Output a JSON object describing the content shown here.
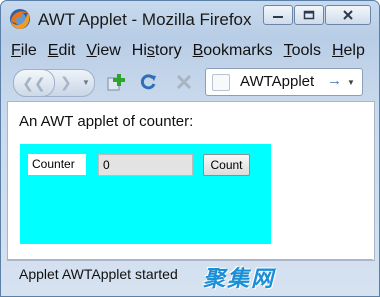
{
  "window": {
    "title": "AWT Applet - Mozilla Firefox"
  },
  "menu": [
    {
      "label": "File",
      "mnemonic": "F",
      "rest": "ile"
    },
    {
      "label": "Edit",
      "mnemonic": "E",
      "rest": "dit"
    },
    {
      "label": "View",
      "mnemonic": "V",
      "rest": "iew"
    },
    {
      "label": "History",
      "pre": "Hi",
      "mnemonic": "s",
      "rest": "tory"
    },
    {
      "label": "Bookmarks",
      "mnemonic": "B",
      "rest": "ookmarks"
    },
    {
      "label": "Tools",
      "mnemonic": "T",
      "rest": "ools"
    },
    {
      "label": "Help",
      "mnemonic": "H",
      "rest": "elp"
    }
  ],
  "toolbar": {
    "icons": [
      "back-icon",
      "forward-icon",
      "add-bookmark-icon",
      "reload-icon",
      "stop-icon"
    ],
    "url": "AWTApplet"
  },
  "content": {
    "intro": "An AWT applet of counter:",
    "applet": {
      "background": "#00ffff",
      "label": "Counter",
      "field_value": "0",
      "button_label": "Count"
    }
  },
  "status": {
    "text": "Applet AWTApplet started"
  },
  "watermark": {
    "text": "聚集网"
  }
}
